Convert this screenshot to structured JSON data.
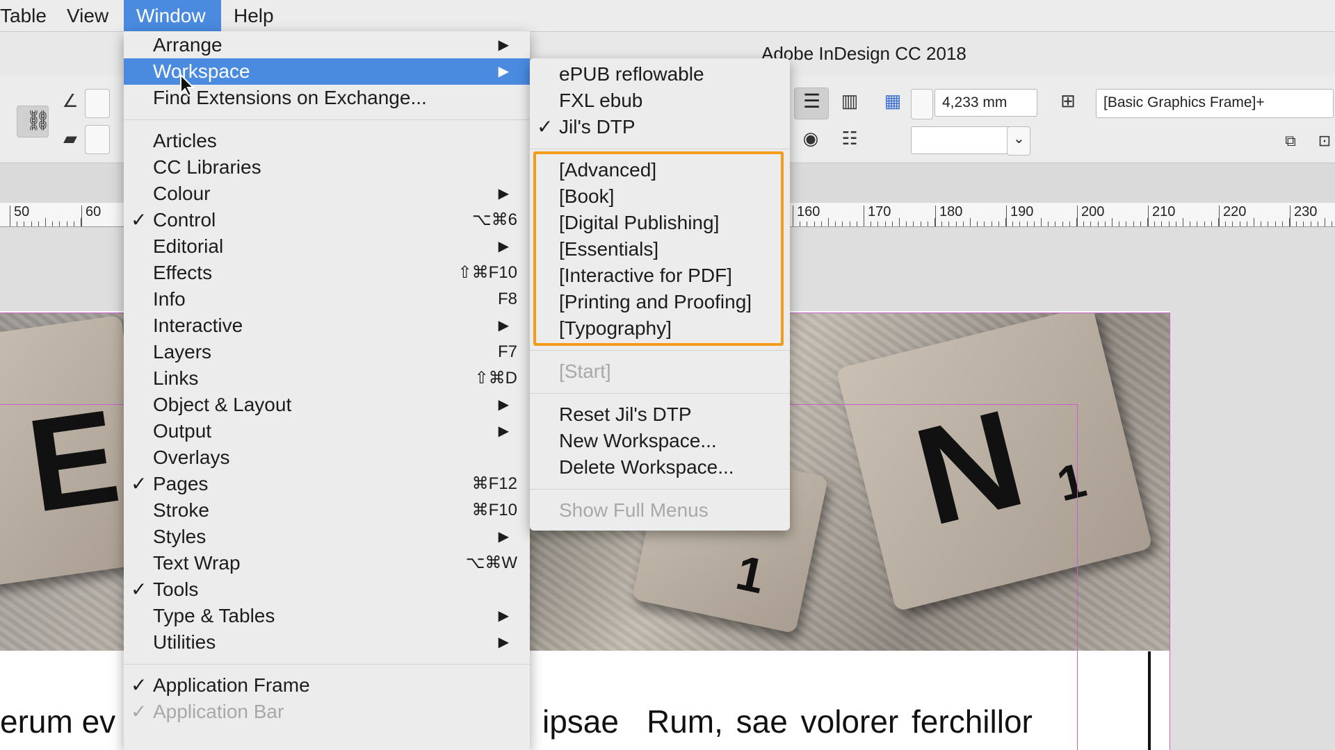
{
  "menubar": {
    "items": [
      "Table",
      "View",
      "Window",
      "Help"
    ],
    "active": "Window"
  },
  "app_title": "Adobe InDesign CC 2018",
  "control_panel": {
    "dimension_value": "4,233 mm",
    "object_style": "[Basic Graphics Frame]+"
  },
  "ruler": {
    "labels": [
      "50",
      "60",
      "160",
      "170",
      "180",
      "190",
      "200",
      "210",
      "220",
      "230"
    ]
  },
  "body_text": {
    "left_fragment": "erum   ev",
    "mid_fragment": "ipsae",
    "right_fragment": "Rum,   sae   volorer   ferchillor"
  },
  "photo_tiles": {
    "letter_left": "E",
    "letter_right": "N",
    "sub_right": "1",
    "sub_mid": "1"
  },
  "window_menu": {
    "items": [
      {
        "label": "Arrange",
        "submenu": true
      },
      {
        "label": "Workspace",
        "submenu": true,
        "highlighted": true
      },
      {
        "label": "Find Extensions on Exchange..."
      },
      {
        "separator": true
      },
      {
        "label": "Articles"
      },
      {
        "label": "CC Libraries"
      },
      {
        "label": "Colour",
        "submenu": true
      },
      {
        "label": "Control",
        "checked": true,
        "shortcut": "⌥⌘6"
      },
      {
        "label": "Editorial",
        "submenu": true
      },
      {
        "label": "Effects",
        "shortcut": "⇧⌘F10"
      },
      {
        "label": "Info",
        "shortcut": "F8"
      },
      {
        "label": "Interactive",
        "submenu": true
      },
      {
        "label": "Layers",
        "shortcut": "F7"
      },
      {
        "label": "Links",
        "shortcut": "⇧⌘D"
      },
      {
        "label": "Object & Layout",
        "submenu": true
      },
      {
        "label": "Output",
        "submenu": true
      },
      {
        "label": "Overlays"
      },
      {
        "label": "Pages",
        "checked": true,
        "shortcut": "⌘F12"
      },
      {
        "label": "Stroke",
        "shortcut": "⌘F10"
      },
      {
        "label": "Styles",
        "submenu": true
      },
      {
        "label": "Text Wrap",
        "shortcut": "⌥⌘W"
      },
      {
        "label": "Tools",
        "checked": true
      },
      {
        "label": "Type & Tables",
        "submenu": true
      },
      {
        "label": "Utilities",
        "submenu": true
      },
      {
        "separator": true
      },
      {
        "label": "Application Frame",
        "checked": true
      },
      {
        "label": "Application Bar",
        "checked": true,
        "disabled": true
      }
    ]
  },
  "workspace_menu": {
    "items": [
      {
        "label": "ePUB reflowable"
      },
      {
        "label": "FXL ebub"
      },
      {
        "label": "Jil's DTP",
        "checked": true
      },
      {
        "separator": true
      },
      {
        "label": "[Advanced]"
      },
      {
        "label": "[Book]"
      },
      {
        "label": "[Digital Publishing]"
      },
      {
        "label": "[Essentials]"
      },
      {
        "label": "[Interactive for PDF]"
      },
      {
        "label": "[Printing and Proofing]"
      },
      {
        "label": "[Typography]"
      },
      {
        "separator": true
      },
      {
        "label": "[Start]",
        "disabled": true
      },
      {
        "separator": true
      },
      {
        "label": "Reset Jil's DTP"
      },
      {
        "label": "New Workspace..."
      },
      {
        "label": "Delete Workspace..."
      },
      {
        "separator": true
      },
      {
        "label": "Show Full Menus",
        "disabled": true
      }
    ]
  },
  "colors": {
    "highlight": "#4a8be0",
    "annotation_box": "#f39c1a",
    "margin_guide": "#c860c8"
  }
}
